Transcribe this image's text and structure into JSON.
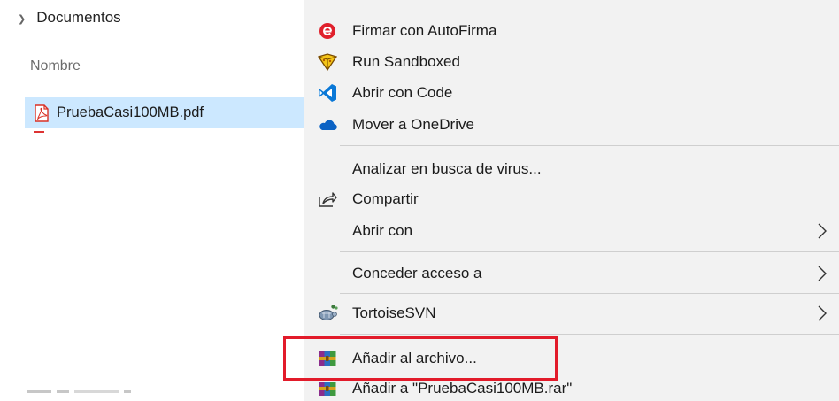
{
  "explorer": {
    "breadcrumb": "Documentos",
    "column_header": "Nombre",
    "selected_file": "PruebaCasi100MB.pdf"
  },
  "context_menu": {
    "items": [
      {
        "label": "Firmar con AutoFirma",
        "icon": "autofirma-icon"
      },
      {
        "label": "Run Sandboxed",
        "icon": "sandboxie-icon"
      },
      {
        "label": "Abrir con Code",
        "icon": "vscode-icon"
      },
      {
        "label": "Mover a OneDrive",
        "icon": "onedrive-cloud-icon"
      },
      {
        "label": "Analizar en busca de virus...",
        "icon": ""
      },
      {
        "label": "Compartir",
        "icon": "share-icon"
      },
      {
        "label": "Abrir con",
        "icon": "",
        "submenu": true
      },
      {
        "label": "Conceder acceso a",
        "icon": "",
        "submenu": true
      },
      {
        "label": "TortoiseSVN",
        "icon": "tortoisesvn-icon",
        "submenu": true
      },
      {
        "label": "Añadir al archivo...",
        "icon": "winrar-icon",
        "highlighted": true
      },
      {
        "label": "Añadir a \"PruebaCasi100MB.rar\"",
        "icon": "winrar-icon"
      }
    ]
  },
  "colors": {
    "selection": "#cce8ff",
    "menu_background": "#f2f2f2",
    "highlight_border": "#e21b2a",
    "autofirma_red": "#e0202c",
    "vscode_blue": "#0a78d7",
    "onedrive_blue": "#0b62c4"
  }
}
